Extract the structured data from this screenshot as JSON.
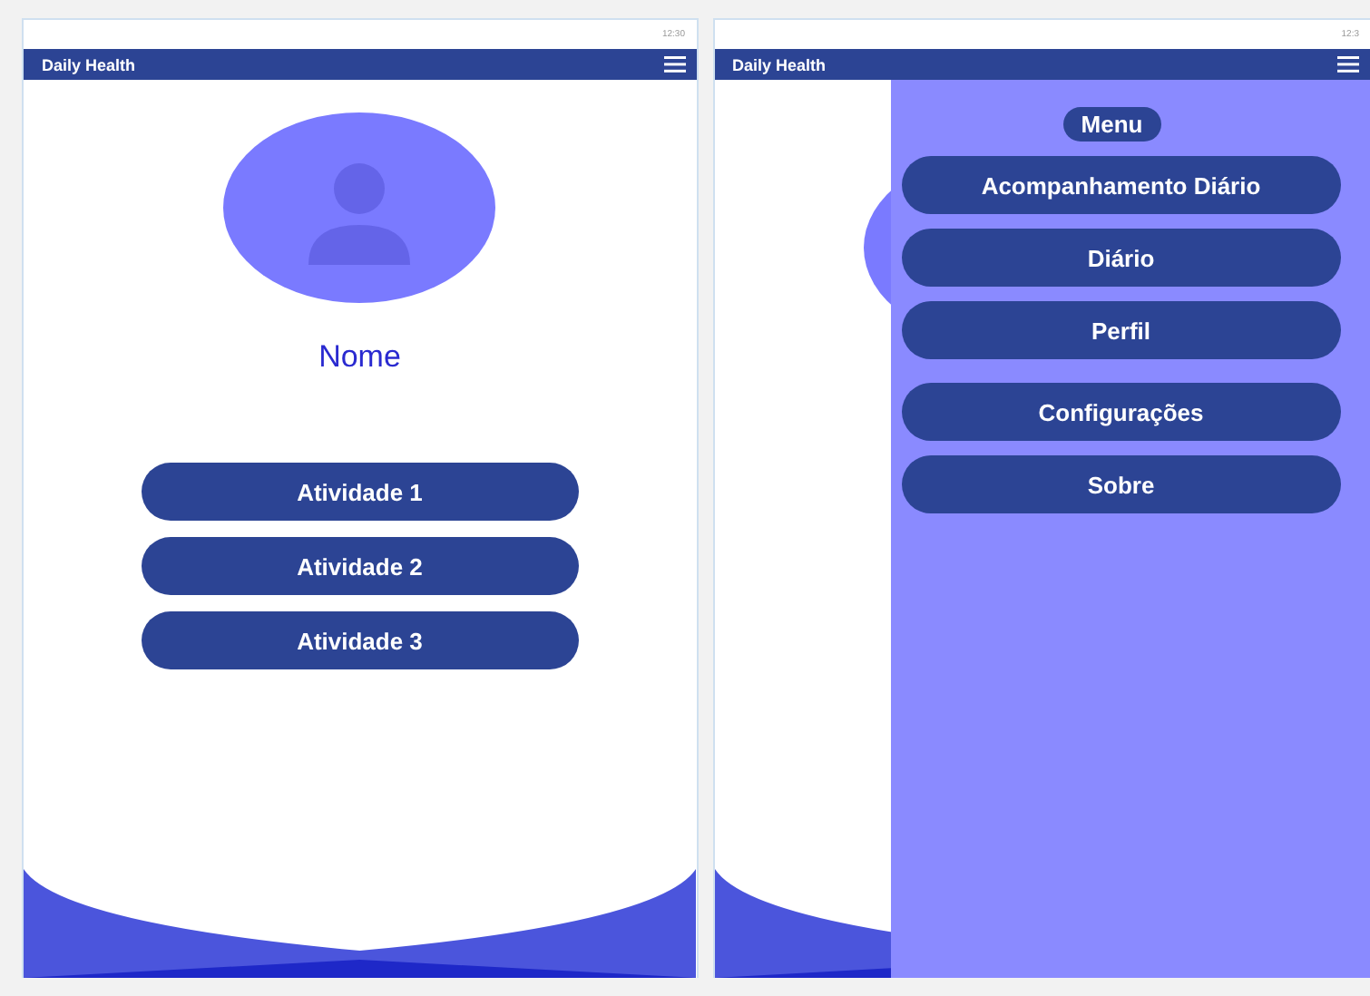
{
  "screens": [
    {
      "status_time": "12:30",
      "app_bar": {
        "title": "Daily Health"
      },
      "profile": {
        "name": "Nome"
      },
      "activities": [
        "Atividade 1",
        "Atividade 2",
        "Atividade 3"
      ]
    },
    {
      "status_time": "12:3",
      "app_bar": {
        "title": "Daily Health"
      },
      "menu": {
        "title": "Menu",
        "items": [
          "Acompanhamento Diário",
          "Diário",
          "Perfil",
          "Configurações",
          "Sobre"
        ]
      }
    }
  ]
}
